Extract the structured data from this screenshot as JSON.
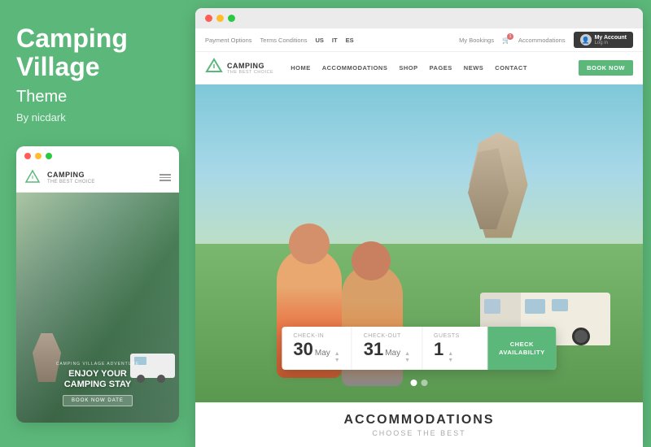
{
  "left": {
    "title_line1": "Camping",
    "title_line2": "Village",
    "subtitle": "Theme",
    "by": "By nicdark"
  },
  "mobile": {
    "brand": "CAMPING",
    "brand_sub": "THE BEST CHOICE",
    "adventure_label": "CAMPING VILLAGE ADVENTURE",
    "enjoy_line1": "ENJOY YOUR",
    "enjoy_line2": "CAMPING STAY",
    "book_btn": "BOOK NOW DATE"
  },
  "browser": {
    "top_bar": {
      "payment_options": "Payment Options",
      "terms": "Terms Conditions",
      "lang_us": "US",
      "lang_it": "IT",
      "lang_es": "ES",
      "my_bookings": "My Bookings",
      "accommodations": "Accommodations",
      "account_label": "My Account",
      "account_sub": "Log in"
    },
    "nav": {
      "brand": "CAMPING",
      "brand_sub": "THE BEST CHOICE",
      "items": [
        "HOME",
        "ACCOMMODATIONS",
        "SHOP",
        "PAGES",
        "NEWS",
        "CONTACT"
      ],
      "book_now": "BOOK NOW"
    },
    "booking": {
      "checkin_label": "CHECK-IN",
      "checkin_day": "30",
      "checkin_month": "May",
      "checkout_label": "CHECK-OUT",
      "checkout_day": "31",
      "checkout_month": "May",
      "guests_label": "GUESTS",
      "guests_count": "1",
      "check_btn_line1": "CHECK",
      "check_btn_line2": "AVAILABILITY"
    },
    "accommodations": {
      "title": "ACCOMMODATIONS",
      "sub": "CHOOSE THE BEST"
    }
  },
  "dots": {
    "active": 0,
    "total": 2
  }
}
